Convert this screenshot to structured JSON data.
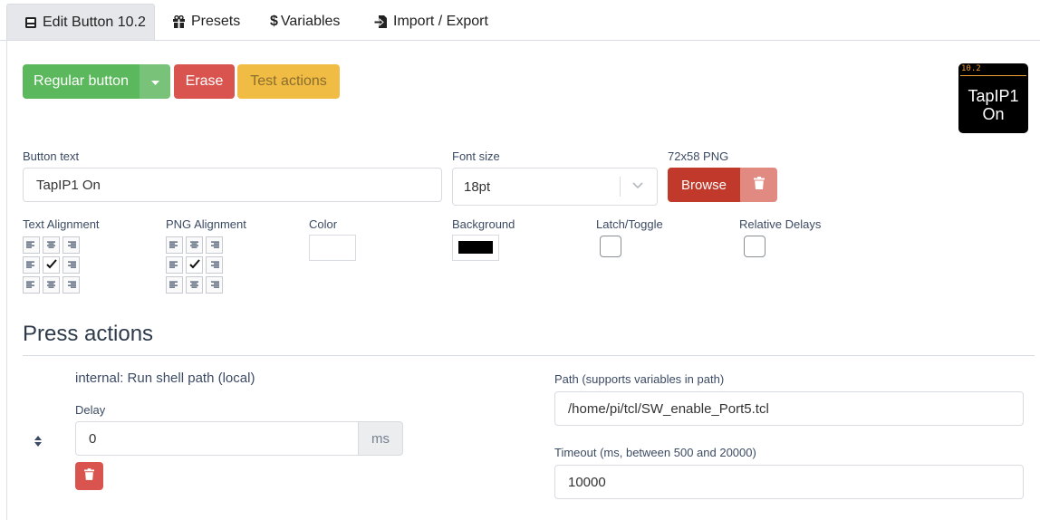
{
  "tabs": [
    {
      "label": "Edit Button 10.2",
      "icon": "keyboard-icon",
      "active": true
    },
    {
      "label": "Presets",
      "icon": "gift-icon",
      "active": false
    },
    {
      "label": "Variables",
      "icon": "dollar-icon",
      "active": false
    },
    {
      "label": "Import / Export",
      "icon": "file-import-icon",
      "active": false
    }
  ],
  "toolbar": {
    "style_label": "Regular button",
    "erase_label": "Erase",
    "test_label": "Test actions"
  },
  "preview": {
    "number": "10.2",
    "line1": "TapIP1",
    "line2": "On"
  },
  "button_text": {
    "label": "Button text",
    "value": "TapIP1 On"
  },
  "font_size": {
    "label": "Font size",
    "value": "18pt"
  },
  "png": {
    "label": "72x58 PNG",
    "browse_label": "Browse"
  },
  "alignment": {
    "text_label": "Text Alignment",
    "png_label": "PNG Alignment",
    "selected": "center"
  },
  "color": {
    "label": "Color",
    "value": "#ffffff"
  },
  "background": {
    "label": "Background",
    "value": "#000000"
  },
  "latch": {
    "label": "Latch/Toggle",
    "checked": false
  },
  "relative_delays": {
    "label": "Relative Delays",
    "checked": false
  },
  "press_actions": {
    "heading": "Press actions",
    "action_name": "internal: Run shell path (local)",
    "delay_label": "Delay",
    "delay_value": "0",
    "delay_unit": "ms",
    "path_label": "Path (supports variables in path)",
    "path_value": "/home/pi/tcl/SW_enable_Port5.tcl",
    "timeout_label": "Timeout (ms, between 500 and 20000)",
    "timeout_value": "10000"
  },
  "colors": {
    "success": "#5cb85c",
    "danger": "#d9534f",
    "warning": "#f0bc44",
    "browse": "#c0392b"
  }
}
